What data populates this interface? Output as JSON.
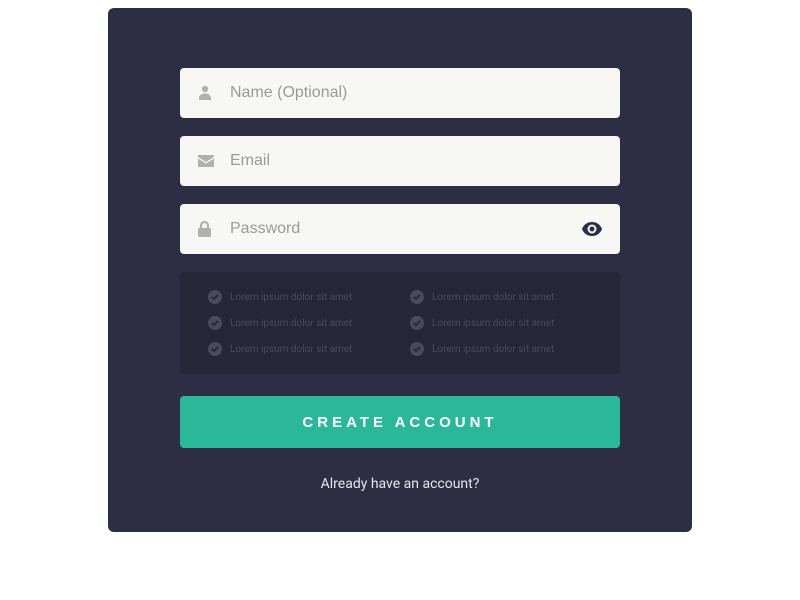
{
  "form": {
    "name_placeholder": "Name (Optional)",
    "email_placeholder": "Email",
    "password_placeholder": "Password",
    "submit_label": "CREATE ACCOUNT",
    "login_link": "Already have an account?"
  },
  "requirements": {
    "items": [
      "Lorem ipsum dolor sit amet",
      "Lorem ipsum dolor sit amet",
      "Lorem ipsum dolor sit amet",
      "Lorem ipsum dolor sit amet",
      "Lorem ipsum dolor sit amet",
      "Lorem ipsum dolor sit amet"
    ]
  },
  "colors": {
    "card_bg": "#2d2d44",
    "requirements_bg": "#262638",
    "button_bg": "#2bb89a",
    "input_bg": "#f7f7f5"
  }
}
